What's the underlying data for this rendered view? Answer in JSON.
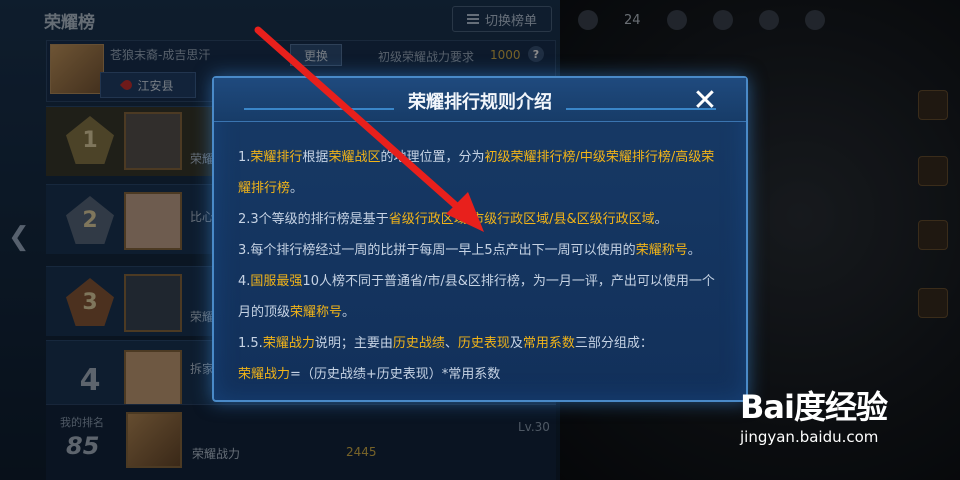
{
  "page": {
    "title": "荣耀榜",
    "switch_label": "切换榜单"
  },
  "player": {
    "name": "苍狼末裔-成吉思汗",
    "change_label": "更换",
    "requirement_label": "初级荣耀战力要求",
    "requirement_value": "1000",
    "help": "?",
    "region": "江安县"
  },
  "ranks": [
    {
      "rank": "1",
      "name": "荣耀"
    },
    {
      "rank": "2",
      "name": "比心"
    },
    {
      "rank": "3",
      "name": "荣耀"
    },
    {
      "rank": "4",
      "name": "拆家"
    }
  ],
  "bottom": {
    "my_rank_label": "我的排名",
    "my_rank_value": "85",
    "power_label": "荣耀战力",
    "power_value": "2445",
    "level": "Lv.30"
  },
  "topbar": {
    "count": "24"
  },
  "dialog": {
    "title": "荣耀排行规则介绍",
    "close": "✕",
    "lines": [
      {
        "segments": [
          {
            "t": "1.",
            "h": false
          },
          {
            "t": "荣耀排行",
            "h": true
          },
          {
            "t": "根据",
            "h": false
          },
          {
            "t": "荣耀战区",
            "h": true
          },
          {
            "t": "的地理位置，分为",
            "h": false
          },
          {
            "t": "初级荣耀排行榜/中级荣耀排行榜/高级荣",
            "h": true
          }
        ]
      },
      {
        "segments": [
          {
            "t": "耀排行榜",
            "h": true
          },
          {
            "t": "。",
            "h": false
          }
        ]
      },
      {
        "segments": [
          {
            "t": "2.3个等级的排行榜是基于",
            "h": false
          },
          {
            "t": "省级行政区域/市级行政区域/县&区级行政区域",
            "h": true
          },
          {
            "t": "。",
            "h": false
          }
        ]
      },
      {
        "segments": [
          {
            "t": "3.每个排行榜经过一周的比拼于每周一早上5点产出下一周可以使用的",
            "h": false
          },
          {
            "t": "荣耀称号",
            "h": true
          },
          {
            "t": "。",
            "h": false
          }
        ]
      },
      {
        "segments": [
          {
            "t": "4.",
            "h": false
          },
          {
            "t": "国服最强",
            "h": true
          },
          {
            "t": "10人榜不同于普通省/市/县&区排行榜，为一月一评，产出可以使用一个",
            "h": false
          }
        ]
      },
      {
        "segments": [
          {
            "t": "月的顶级",
            "h": false
          },
          {
            "t": "荣耀称号",
            "h": true
          },
          {
            "t": "。",
            "h": false
          }
        ]
      },
      {
        "segments": [
          {
            "t": "1.5.",
            "h": false
          },
          {
            "t": "荣耀战力",
            "h": true
          },
          {
            "t": "说明；主要由",
            "h": false
          },
          {
            "t": "历史战绩",
            "h": true
          },
          {
            "t": "、",
            "h": false
          },
          {
            "t": "历史表现",
            "h": true
          },
          {
            "t": "及",
            "h": false
          },
          {
            "t": "常用系数",
            "h": true
          },
          {
            "t": "三部分组成：",
            "h": false
          }
        ]
      },
      {
        "segments": [
          {
            "t": "荣耀战力",
            "h": true
          },
          {
            "t": "=（历史战绩+历史表现）*常用系数",
            "h": false
          }
        ]
      }
    ]
  },
  "watermark": {
    "logo": "Bai度经验",
    "url": "jingyan.baidu.com"
  },
  "colors": {
    "highlight": "#f2b418",
    "dialog_border": "#4a8ac8",
    "arrow": "#e8201c"
  }
}
